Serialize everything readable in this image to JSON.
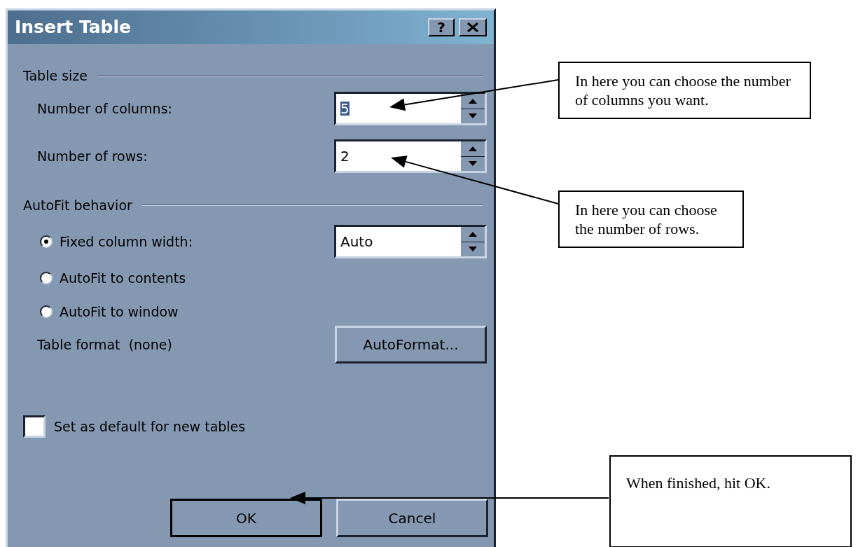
{
  "dialog": {
    "title": "Insert Table",
    "help_button": "?",
    "table_size": {
      "legend": "Table size",
      "fields": [
        {
          "label": "Number of columns:",
          "value": "5",
          "text_selected": true
        },
        {
          "label": "Number of rows:",
          "value": "2",
          "text_selected": false
        }
      ]
    },
    "autofit": {
      "legend": "AutoFit behavior",
      "options": [
        {
          "label": "Fixed column width:",
          "selected": true
        },
        {
          "label": "AutoFit to contents",
          "selected": false
        },
        {
          "label": "AutoFit to window",
          "selected": false
        }
      ],
      "width_field": {
        "value": "Auto"
      }
    },
    "table_format": {
      "label": "Table format",
      "value": "(none)",
      "button": "AutoFormat..."
    },
    "default_checkbox": {
      "label": "Set as default for new tables",
      "checked": false
    },
    "buttons": [
      {
        "label": "OK",
        "default": true
      },
      {
        "label": "Cancel",
        "default": false
      }
    ]
  },
  "callouts": [
    {
      "text": "In here you can choose the number of columns you want."
    },
    {
      "text": "In here you can choose the number of rows."
    },
    {
      "text": "When finished, hit OK."
    }
  ]
}
